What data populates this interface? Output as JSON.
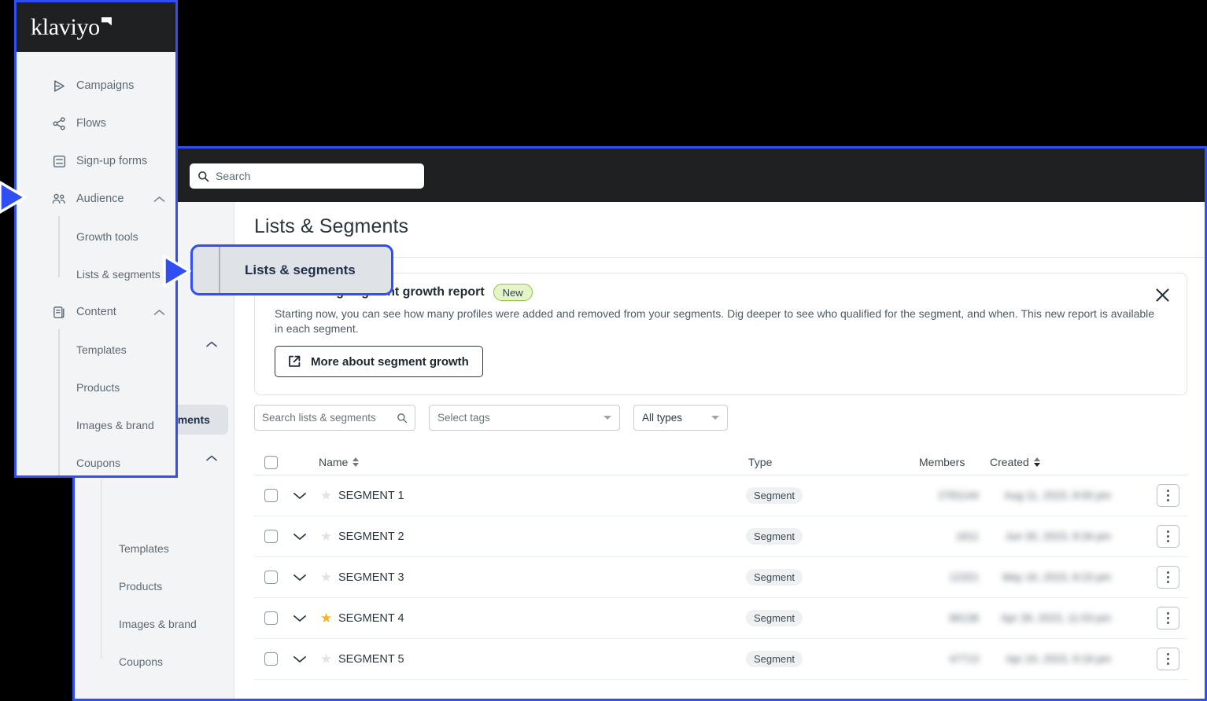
{
  "brand": {
    "name": "klaviyo",
    "accent": "#2f4ff5",
    "dark_bar": "#1f2021"
  },
  "topbar": {
    "search_placeholder": "Search",
    "search_icon": "search-icon"
  },
  "overlay_sidebar": {
    "items": [
      {
        "label": "Campaigns",
        "icon": "send-icon",
        "expandable": false
      },
      {
        "label": "Flows",
        "icon": "flows-icon",
        "expandable": false
      },
      {
        "label": "Sign-up forms",
        "icon": "form-icon",
        "expandable": false
      },
      {
        "label": "Audience",
        "icon": "audience-icon",
        "expandable": true,
        "expanded": true
      },
      {
        "label": "Content",
        "icon": "content-icon",
        "expandable": true,
        "expanded": true
      }
    ],
    "audience_children": [
      "Growth tools",
      "Lists & segments"
    ],
    "content_children": [
      "Templates",
      "Products",
      "Images & brand",
      "Coupons"
    ]
  },
  "callout": {
    "label": "Lists & segments"
  },
  "background_sidebar": {
    "active_item": "Lists & segments",
    "content_children": [
      "Templates",
      "Products",
      "Images & brand",
      "Coupons"
    ]
  },
  "main": {
    "page_title": "Lists & Segments",
    "promo": {
      "title": "Introducing segment growth report",
      "badge": "New",
      "body": "Starting now, you can see how many profiles were added and removed from your segments. Dig deeper to see who qualified for the segment, and when. This new report is available in each segment.",
      "button": "More about segment growth",
      "button_icon": "external-link-icon",
      "close_icon": "close-icon",
      "badge_border": "#8cc63f",
      "badge_bg": "#e6f5c8"
    },
    "filters": {
      "search_placeholder": "Search lists & segments",
      "search_icon": "search-icon",
      "tags_placeholder": "Select tags",
      "types_value": "All types"
    },
    "table": {
      "columns": [
        "Name",
        "Type",
        "Members",
        "Created"
      ],
      "sorted_column": "Created",
      "rows": [
        {
          "name": "SEGMENT 1",
          "type": "Segment",
          "starred": false,
          "members": "2781144",
          "created": "Aug 11, 2023, 8:00 pm"
        },
        {
          "name": "SEGMENT 2",
          "type": "Segment",
          "starred": false,
          "members": "1611",
          "created": "Jun 30, 2023, 8:34 pm"
        },
        {
          "name": "SEGMENT 3",
          "type": "Segment",
          "starred": false,
          "members": "12321",
          "created": "May 16, 2023, 8:23 pm"
        },
        {
          "name": "SEGMENT 4",
          "type": "Segment",
          "starred": true,
          "members": "86138",
          "created": "Apr 28, 2023, 11:03 pm"
        },
        {
          "name": "SEGMENT 5",
          "type": "Segment",
          "starred": false,
          "members": "47713",
          "created": "Apr 24, 2023, 9:18 pm"
        }
      ],
      "row_menu_icon": "kebab-menu-icon",
      "row_expand_icon": "chevron-down-icon",
      "star_icon": "star-icon",
      "select_all_icon": "checkbox-icon"
    }
  }
}
